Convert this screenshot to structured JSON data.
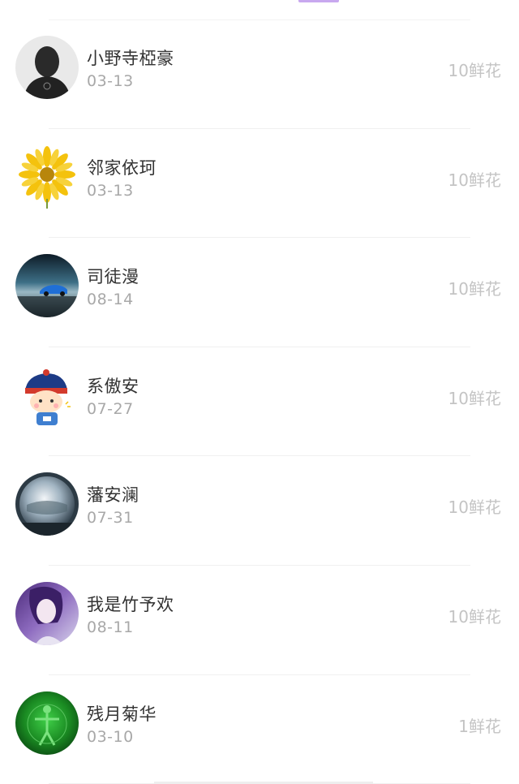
{
  "users": [
    {
      "name": "小野寺椏豪",
      "date": "03-13",
      "gift": "10鲜花",
      "avatar": "avatar-photo-person-bw"
    },
    {
      "name": "邻家依珂",
      "date": "03-13",
      "gift": "10鲜花",
      "avatar": "avatar-photo-sunflower"
    },
    {
      "name": "司徒漫",
      "date": "08-14",
      "gift": "10鲜花",
      "avatar": "avatar-photo-blue-car"
    },
    {
      "name": "系傲安",
      "date": "07-27",
      "gift": "10鲜花",
      "avatar": "avatar-cartoon-qing-boy"
    },
    {
      "name": "藩安澜",
      "date": "07-31",
      "gift": "10鲜花",
      "avatar": "avatar-photo-crystal-ball"
    },
    {
      "name": "我是竹予欢",
      "date": "08-11",
      "gift": "10鲜花",
      "avatar": "avatar-anime-purple-hair"
    },
    {
      "name": "残月菊华",
      "date": "03-10",
      "gift": "1鲜花",
      "avatar": "avatar-photo-green-figure"
    }
  ]
}
